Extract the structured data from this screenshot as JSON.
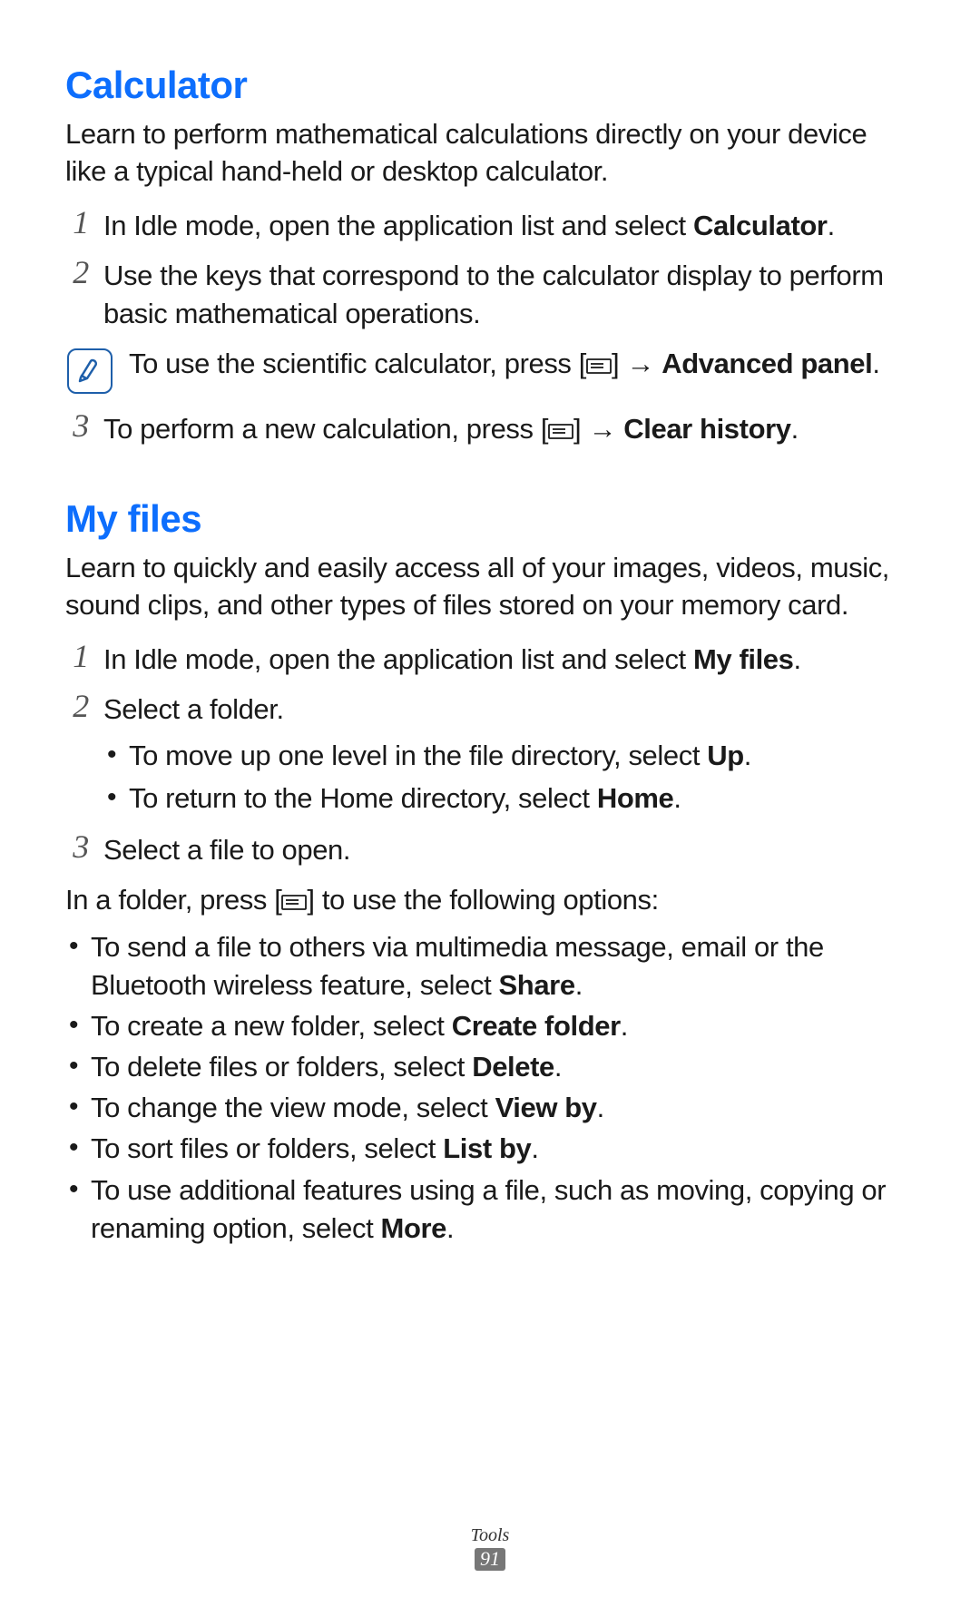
{
  "section1": {
    "title": "Calculator",
    "intro": "Learn to perform mathematical calculations directly on your device like a typical hand-held or desktop calculator.",
    "step1_pre": "In Idle mode, open the application list and select ",
    "step1_b": "Calculator",
    "step1_post": ".",
    "step2": "Use the keys that correspond to the calculator display to perform basic mathematical operations.",
    "note_pre": "To use the scientific calculator, press [",
    "note_mid": "] → ",
    "note_b": "Advanced panel",
    "note_post": ".",
    "step3_pre": "To perform a new calculation, press [",
    "step3_mid": "] → ",
    "step3_b": "Clear history",
    "step3_post": "."
  },
  "section2": {
    "title": "My files",
    "intro": "Learn to quickly and easily access all of your images, videos, music, sound clips, and other types of files stored on your memory card.",
    "step1_pre": "In Idle mode, open the application list and select ",
    "step1_b": "My files",
    "step1_post": ".",
    "step2": "Select a folder.",
    "sub1_pre": "To move up one level in the file directory, select ",
    "sub1_b": "Up",
    "sub1_post": ".",
    "sub2_pre": "To return to the Home directory, select ",
    "sub2_b": "Home",
    "sub2_post": ".",
    "step3": "Select a file to open.",
    "body_pre": "In a folder, press [",
    "body_post": "] to use the following options:",
    "opt1_pre": "To send a file to others via multimedia message, email or the Bluetooth wireless feature, select ",
    "opt1_b": "Share",
    "opt1_post": ".",
    "opt2_pre": "To create a new folder, select ",
    "opt2_b": "Create folder",
    "opt2_post": ".",
    "opt3_pre": "To delete files or folders, select ",
    "opt3_b": "Delete",
    "opt3_post": ".",
    "opt4_pre": "To change the view mode, select ",
    "opt4_b": "View by",
    "opt4_post": ".",
    "opt5_pre": "To sort files or folders, select ",
    "opt5_b": "List by",
    "opt5_post": ".",
    "opt6_pre": "To use additional features using a file, such as moving, copying or renaming option, select ",
    "opt6_b": "More",
    "opt6_post": "."
  },
  "footer": {
    "label": "Tools",
    "page": "91"
  },
  "numbers": {
    "n1": "1",
    "n2": "2",
    "n3": "3"
  }
}
